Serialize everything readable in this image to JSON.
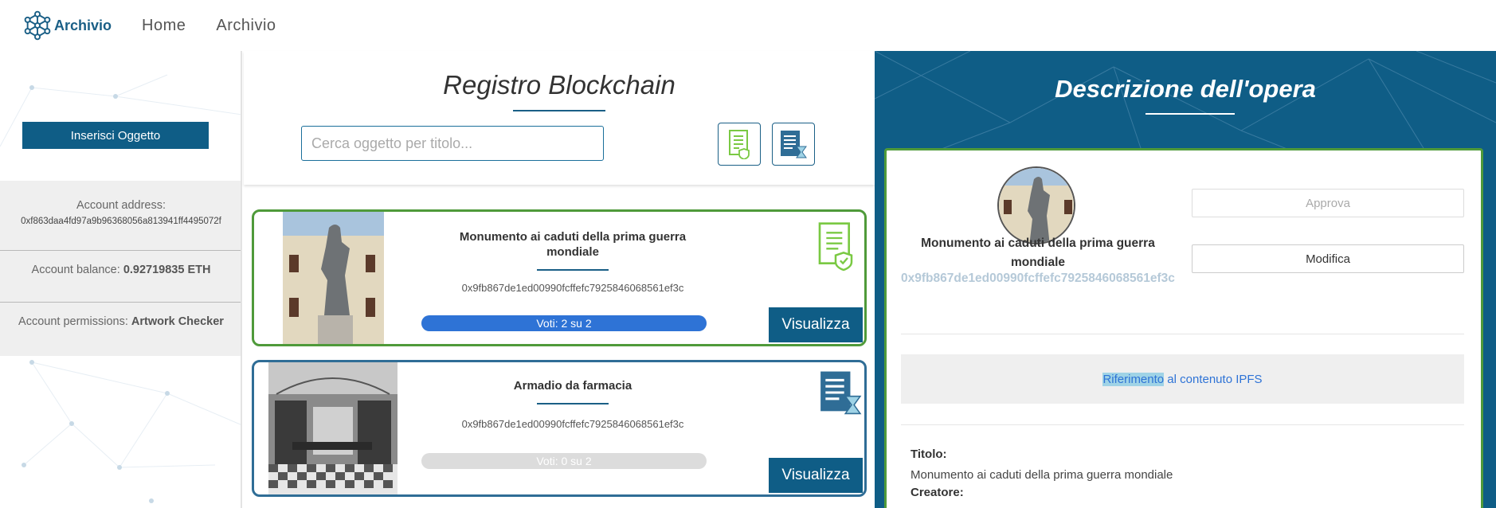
{
  "nav": {
    "brand": "Archivio",
    "links": [
      "Home",
      "Archivio"
    ]
  },
  "sidebar": {
    "insert_button": "Inserisci Oggetto",
    "account_address_label": "Account address:",
    "account_address": "0xf863daa4fd97a9b96368056a813941ff4495072f",
    "balance_label": "Account balance: ",
    "balance_value": "0.92719835 ETH",
    "permissions_label": "Account permissions: ",
    "permissions_value": "Artwork Checker"
  },
  "registry": {
    "title": "Registro Blockchain",
    "search_placeholder": "Cerca oggetto per titolo...",
    "filters": [
      "approved-document-icon",
      "pending-document-icon"
    ],
    "items": [
      {
        "title": "Monumento ai caduti della prima guerra mondiale",
        "hash": "0x9fb867de1ed00990fcffefc7925846068561ef3c",
        "votes_label": "Voti: 2 su 2",
        "votes_fraction": 1.0,
        "status": "approved",
        "button": "Visualizza"
      },
      {
        "title": "Armadio da farmacia",
        "hash": "0x9fb867de1ed00990fcffefc7925846068561ef3c",
        "votes_label": "Voti: 0 su 2",
        "votes_fraction": 0.0,
        "status": "pending",
        "button": "Visualizza"
      }
    ]
  },
  "description": {
    "title": "Descrizione dell'opera",
    "name": "Monumento ai caduti della prima guerra mondiale",
    "hash": "0x9fb867de1ed00990fcffefc7925846068561ef3c",
    "approve_button": "Approva",
    "edit_button": "Modifica",
    "ipfs_link_highlight": "Riferimento",
    "ipfs_link_rest": " al contenuto IPFS",
    "title_label": "Titolo:",
    "title_value": "Monumento ai caduti della prima guerra mondiale",
    "creator_label": "Creatore:"
  },
  "colors": {
    "primary": "#0f5d86",
    "approved_border": "#4f9a3a",
    "pending_border": "#2f6d96",
    "progress": "#2e73d6"
  }
}
